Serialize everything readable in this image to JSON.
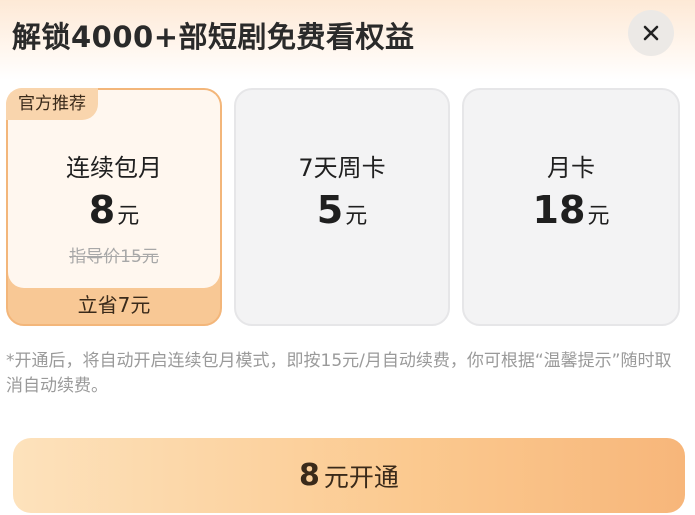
{
  "header": {
    "title": "解锁4000+部短剧免费看权益",
    "close_icon": "close-icon"
  },
  "plans": [
    {
      "badge": "官方推荐",
      "name": "连续包月",
      "price": "8",
      "unit": "元",
      "original_price": "指导价15元",
      "savings": "立省7元",
      "selected": true
    },
    {
      "name": "7天周卡",
      "price": "5",
      "unit": "元",
      "selected": false
    },
    {
      "name": "月卡",
      "price": "18",
      "unit": "元",
      "selected": false
    }
  ],
  "notice": "*开通后，将自动开启连续包月模式，即按15元/月自动续费，你可根据“温馨提示”随时取消自动续费。",
  "cta": {
    "price": "8",
    "label": "元开通"
  },
  "colors": {
    "accent": "#f7b67a",
    "selected_card": "#f8c895",
    "card_bg": "#f3f3f4"
  }
}
